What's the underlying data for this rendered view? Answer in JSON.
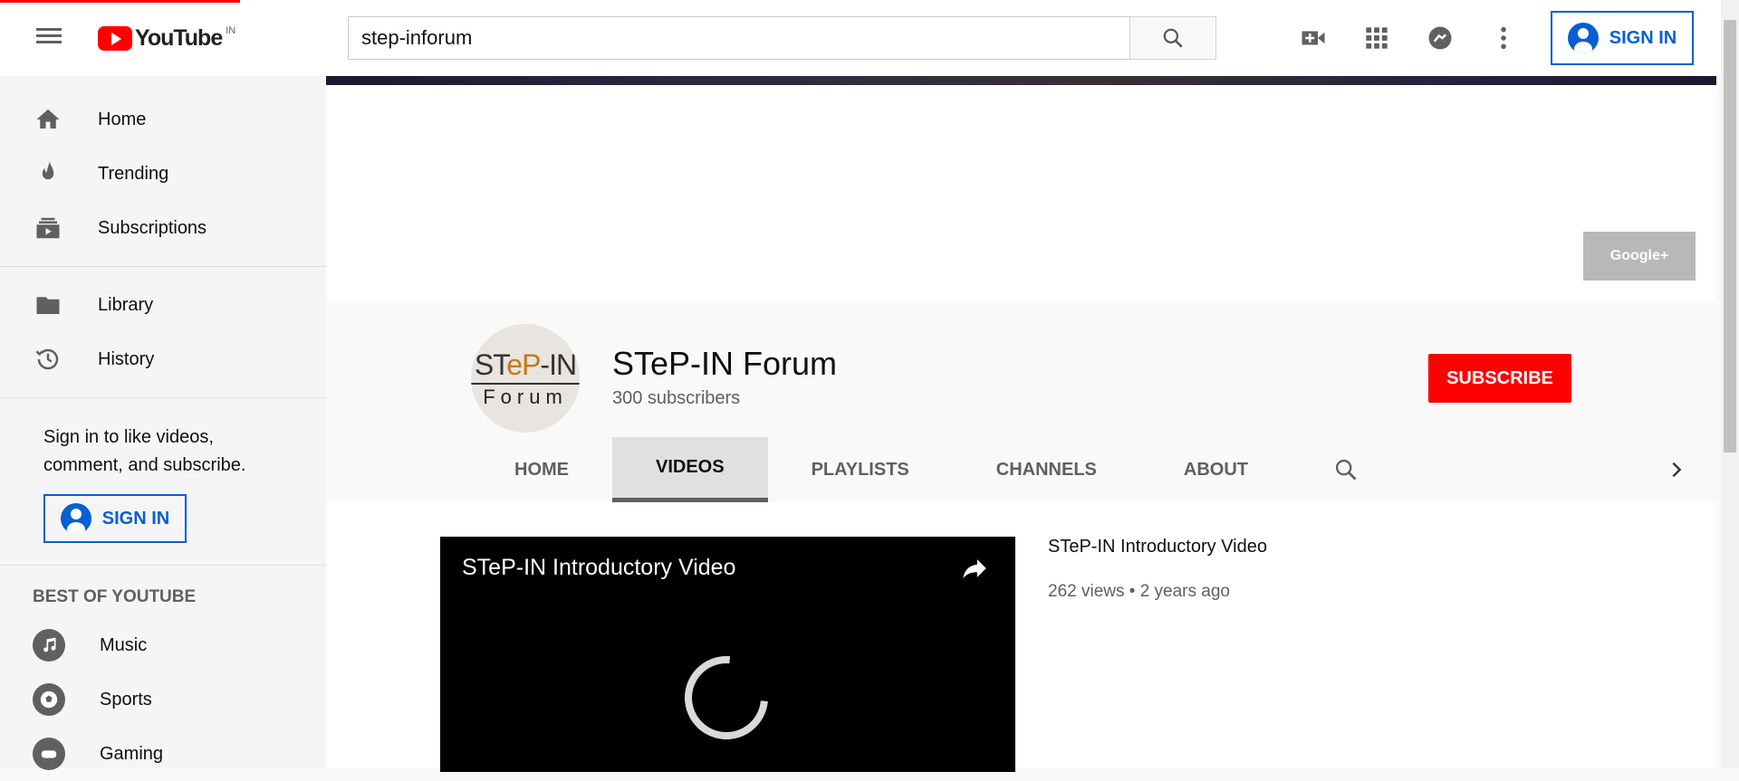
{
  "header": {
    "logo_text": "YouTube",
    "region": "IN",
    "search_value": "step-inforum",
    "signin_label": "SIGN IN"
  },
  "sidebar": {
    "items": [
      {
        "label": "Home"
      },
      {
        "label": "Trending"
      },
      {
        "label": "Subscriptions"
      },
      {
        "label": "Library"
      },
      {
        "label": "History"
      }
    ],
    "signin_prompt": "Sign in to like videos, comment, and subscribe.",
    "signin_label": "SIGN IN",
    "section_title": "BEST OF YOUTUBE",
    "categories": [
      {
        "label": "Music"
      },
      {
        "label": "Sports"
      },
      {
        "label": "Gaming"
      }
    ]
  },
  "banner": {
    "gplus_label": "Google+"
  },
  "channel": {
    "avatar_line1_a": "ST",
    "avatar_line1_b": "eP",
    "avatar_line1_c": "-IN",
    "avatar_line2": "Forum",
    "name": "STeP-IN Forum",
    "subscribers": "300 subscribers",
    "subscribe_label": "SUBSCRIBE",
    "tabs": [
      {
        "label": "HOME"
      },
      {
        "label": "VIDEOS"
      },
      {
        "label": "PLAYLISTS"
      },
      {
        "label": "CHANNELS"
      },
      {
        "label": "ABOUT"
      }
    ],
    "active_tab": "VIDEOS"
  },
  "video": {
    "player_title": "STeP-IN Introductory Video",
    "title": "STeP-IN Introductory Video",
    "meta": "262 views • 2 years ago"
  },
  "colors": {
    "brand_red": "#ff0000",
    "link_blue": "#065fd4"
  }
}
